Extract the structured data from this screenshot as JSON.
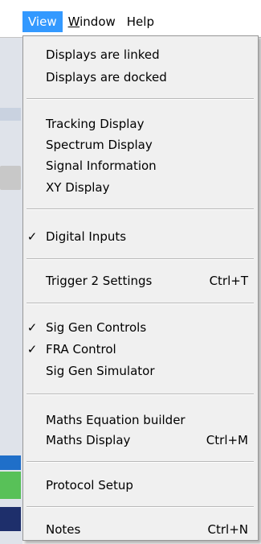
{
  "menubar": {
    "items": [
      {
        "label": "View",
        "active": true
      },
      {
        "label": "Window",
        "mnemonic": "W",
        "rest": "indow"
      },
      {
        "label": "Help"
      }
    ]
  },
  "view_menu": {
    "items": [
      {
        "label": "Displays are linked",
        "checked": false,
        "shortcut": ""
      },
      {
        "label": "Displays are docked",
        "checked": false,
        "shortcut": ""
      },
      {
        "label": "Tracking Display",
        "checked": false,
        "shortcut": ""
      },
      {
        "label": "Spectrum Display",
        "checked": false,
        "shortcut": ""
      },
      {
        "label": "Signal Information",
        "checked": false,
        "shortcut": ""
      },
      {
        "label": "XY Display",
        "checked": false,
        "shortcut": ""
      },
      {
        "label": "Digital Inputs",
        "checked": true,
        "check_glyph": "✓",
        "shortcut": ""
      },
      {
        "label": "Trigger 2 Settings",
        "checked": false,
        "shortcut": "Ctrl+T"
      },
      {
        "label": "Sig Gen Controls",
        "checked": true,
        "check_glyph": "✓",
        "shortcut": ""
      },
      {
        "label": "FRA Control",
        "checked": true,
        "check_glyph": "✓",
        "shortcut": ""
      },
      {
        "label": "Sig Gen Simulator",
        "checked": false,
        "shortcut": ""
      },
      {
        "label": "Maths Equation builder",
        "checked": false,
        "shortcut": ""
      },
      {
        "label": "Maths Display",
        "checked": false,
        "shortcut": "Ctrl+M"
      },
      {
        "label": "Protocol Setup",
        "checked": false,
        "shortcut": ""
      },
      {
        "label": "Notes",
        "checked": false,
        "shortcut": "Ctrl+N"
      }
    ]
  },
  "colors": {
    "menu_highlight": "#3399ff",
    "menu_background": "#f0f0f0",
    "text": "#000000"
  }
}
